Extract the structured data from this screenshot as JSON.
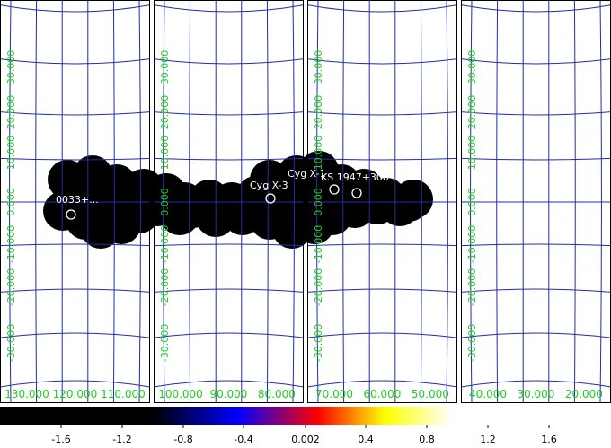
{
  "colors": {
    "grid": "#1f2fa8",
    "frame": "#000000",
    "coord_label": "#22cc22",
    "source_label": "#ffffff",
    "background": "#ffffff",
    "blob": "#000000"
  },
  "panels": [
    {
      "id": "panel-1",
      "ra_labels": [
        "130.000",
        "120.000",
        "110.000"
      ]
    },
    {
      "id": "panel-2",
      "ra_labels": [
        "100.000",
        "90.000",
        "80.000"
      ]
    },
    {
      "id": "panel-3",
      "ra_labels": [
        "70.000",
        "60.000",
        "50.000"
      ]
    },
    {
      "id": "panel-4",
      "ra_labels": [
        "40.000",
        "30.000",
        "20.000"
      ]
    }
  ],
  "dec_labels": [
    "30.000",
    "20.000",
    "10.000",
    "0.000",
    "-10.000",
    "-20.000",
    "-30.000"
  ],
  "sources": [
    {
      "name": "0033",
      "label": "0033+..."
    },
    {
      "name": "Cyg X-3",
      "label": "Cyg X-3"
    },
    {
      "name": "Cyg X-1",
      "label": "Cyg X-1"
    },
    {
      "name": "KS 1947+300",
      "label": "KS 1947+300"
    }
  ],
  "colorbar": {
    "ticks": [
      "-1.6",
      "-1.2",
      "-0.8",
      "-0.4",
      "0.002",
      "0.4",
      "0.8",
      "1.2",
      "1.6"
    ],
    "stops": [
      "#000000",
      "#000000",
      "#0000ff",
      "#ff0000",
      "#ffff00",
      "#ffffff",
      "#ffffff"
    ]
  }
}
